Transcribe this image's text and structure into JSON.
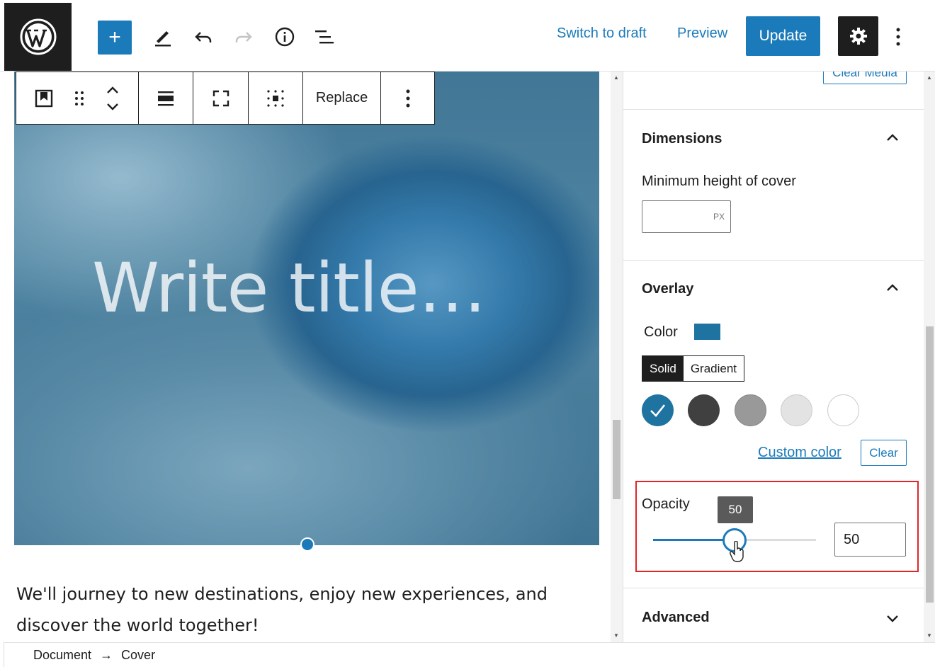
{
  "topbar": {
    "add_label": "+",
    "switch_to_draft": "Switch to draft",
    "preview": "Preview",
    "update": "Update",
    "icons": [
      "wordpress-logo",
      "plus-icon",
      "pencil-icon",
      "undo-icon",
      "redo-icon",
      "info-icon",
      "list-view-icon",
      "gear-icon",
      "more-vertical-icon"
    ]
  },
  "block_toolbar": {
    "replace": "Replace"
  },
  "cover": {
    "title_placeholder": "Write title…"
  },
  "paragraph": {
    "text": "We'll journey to new destinations, enjoy new experiences, and discover the world together!"
  },
  "sidebar": {
    "clear_media": "Clear Media",
    "dimensions": {
      "title": "Dimensions",
      "min_height_label": "Minimum height of cover",
      "unit": "PX",
      "value": ""
    },
    "overlay": {
      "title": "Overlay",
      "color_label": "Color",
      "selected_color": "#1e73a0",
      "tabs": [
        "Solid",
        "Gradient"
      ],
      "active_tab": "Solid",
      "swatches": [
        "#1e73a0",
        "#404040",
        "#999999",
        "#e3e3e3",
        "#ffffff"
      ],
      "custom_color": "Custom color",
      "clear": "Clear"
    },
    "opacity": {
      "label": "Opacity",
      "tooltip": "50",
      "value": "50",
      "percent": 50
    },
    "advanced": {
      "title": "Advanced"
    }
  },
  "breadcrumb": {
    "items": [
      "Document",
      "Cover"
    ],
    "separator": "→"
  }
}
